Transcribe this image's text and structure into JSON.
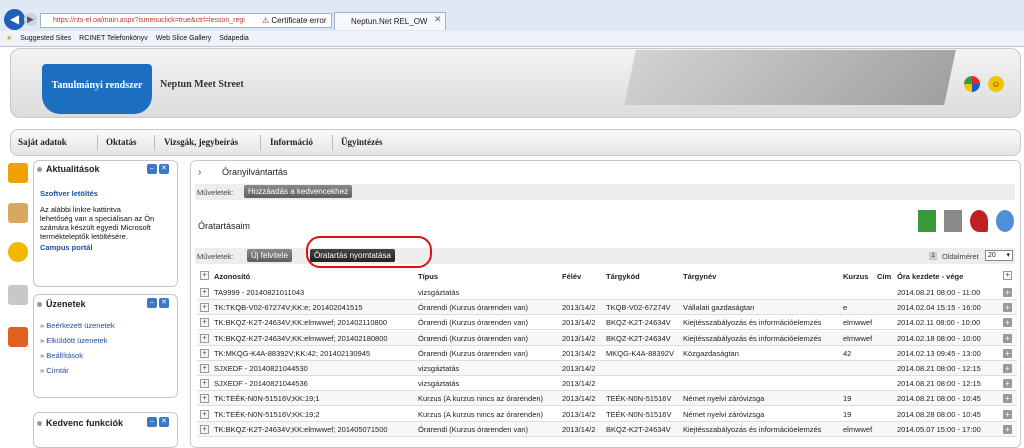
{
  "browser": {
    "address": "https://nts-el.oa/main.aspx?ismenuclick=true&ctrl=lesson_regi",
    "cert_error": "Certificate error",
    "tab_title": "Neptun.Net REL_OW",
    "favorites": [
      "Suggested Sites",
      "RCINET Telefonkönyv",
      "Web Slice Gallery",
      "Sdapedia"
    ]
  },
  "header": {
    "logo_text": "Tanulmányi rendszer",
    "site_name": "Neptun Meet Street"
  },
  "nav": {
    "items": [
      "Saját adatok",
      "Oktatás",
      "Vizsgák, jegybeírás",
      "Információ",
      "Ügyintézés"
    ]
  },
  "sidebar": {
    "news": {
      "title": "Aktualitások",
      "link1": "Szoftver letöltés",
      "text": [
        "Az alábbi linkre kattintva",
        "lehetőség van a speciálisan az Ön",
        "számára készült egyedi Microsoft",
        "termékteleptők letöltésére."
      ],
      "link2": "Campus portál"
    },
    "messages": {
      "title": "Üzenetek",
      "items": [
        "Beérkezett üzenetek",
        "Elküldött üzenetek",
        "Beállítások",
        "Címtár"
      ]
    },
    "favorites": {
      "title": "Kedvenc funkciók"
    }
  },
  "main": {
    "title": "Óranyilvántartás",
    "actions_label": "Műveletek:",
    "add_fav": "Hozzáadás a kedvencekhez",
    "subtitle": "Óratartásaim",
    "new_btn": "Új felvitele",
    "print_btn": "Óratartás nyomtatása",
    "pagesize_label": "Oldalméret",
    "page_num": "1",
    "pagesize": "20",
    "columns": [
      "Azonosító",
      "Típus",
      "Félév",
      "Tárgykód",
      "Tárgynév",
      "Kurzus",
      "Cím",
      "Óra kezdete - vége"
    ],
    "rows": [
      [
        "TA9999 - 20140821011043",
        "vizsgáztatás",
        "",
        "",
        "",
        "",
        "",
        "2014.08.21 08:00 - 11:00"
      ],
      [
        "TK:TKQB-V02-67274V;KK:e; 201402041515",
        "Órarendi (Kurzus órarenden van)",
        "2013/14/2",
        "TKQB-V02-67274V",
        "Vállalati gazdaságtan",
        "e",
        "",
        "2014.02.04 15:15 - 16:00"
      ],
      [
        "TK:BKQZ-K2T-24634V;KK:elmwwef; 201402110800",
        "Órarendi (Kurzus órarenden van)",
        "2013/14/2",
        "BKQZ-K2T-24634V",
        "Kiejtésszabályozás és információelemzés",
        "elmwwef",
        "",
        "2014.02.11 08:00 - 10:00"
      ],
      [
        "TK:BKQZ-K2T-24634V;KK:elmwwef; 201402180800",
        "Órarendi (Kurzus órarenden van)",
        "2013/14/2",
        "BKQZ-K2T-24634V",
        "Kiejtésszabályozás és információelemzés",
        "elmwwef",
        "",
        "2014.02.18 08:00 - 10:00"
      ],
      [
        "TK:MKQG-K4A-88392V;KK:42; 201402130945",
        "Órarendi (Kurzus órarenden van)",
        "2013/14/2",
        "MKQG-K4A-88392V",
        "Közgazdaságtan",
        "42",
        "",
        "2014.02.13 09:45 - 13:00"
      ],
      [
        "SJXEDF - 20140821044530",
        "vizsgáztatás",
        "2013/14/2",
        "",
        "",
        "",
        "",
        "2014.08.21 08:00 - 12:15"
      ],
      [
        "SJXEDF - 20140821044536",
        "vizsgáztatás",
        "2013/14/2",
        "",
        "",
        "",
        "",
        "2014.08.21 08:00 - 12:15"
      ],
      [
        "TK:TEÉK-N0N-51516V;KK:19;1",
        "Kurzus (A kurzus nincs az órarenden)",
        "2013/14/2",
        "TEÉK-N0N-51516V",
        "Német nyelvi záróvizsga",
        "19",
        "",
        "2014.08.21 08:00 - 10:45"
      ],
      [
        "TK:TEÉK-N0N-51516V;KK:19;2",
        "Kurzus (A kurzus nincs az órarenden)",
        "2013/14/2",
        "TEÉK-N0N-51516V",
        "Német nyelvi záróvizsga",
        "19",
        "",
        "2014.08.28 08:00 - 10:45"
      ],
      [
        "TK:BKQZ-K2T-24634V;KK:elmwwef; 201405071500",
        "Órarendi (Kurzus órarenden van)",
        "2013/14/2",
        "BKQZ-K2T-24634V",
        "Kiejtésszabályozás és információelemzés",
        "elmwwef",
        "",
        "2014.05.07 15:00 - 17:00"
      ]
    ]
  },
  "colors": {
    "accent": "#1c6fc0",
    "highlight": "#dd1111",
    "button": "#6b6b6b"
  }
}
